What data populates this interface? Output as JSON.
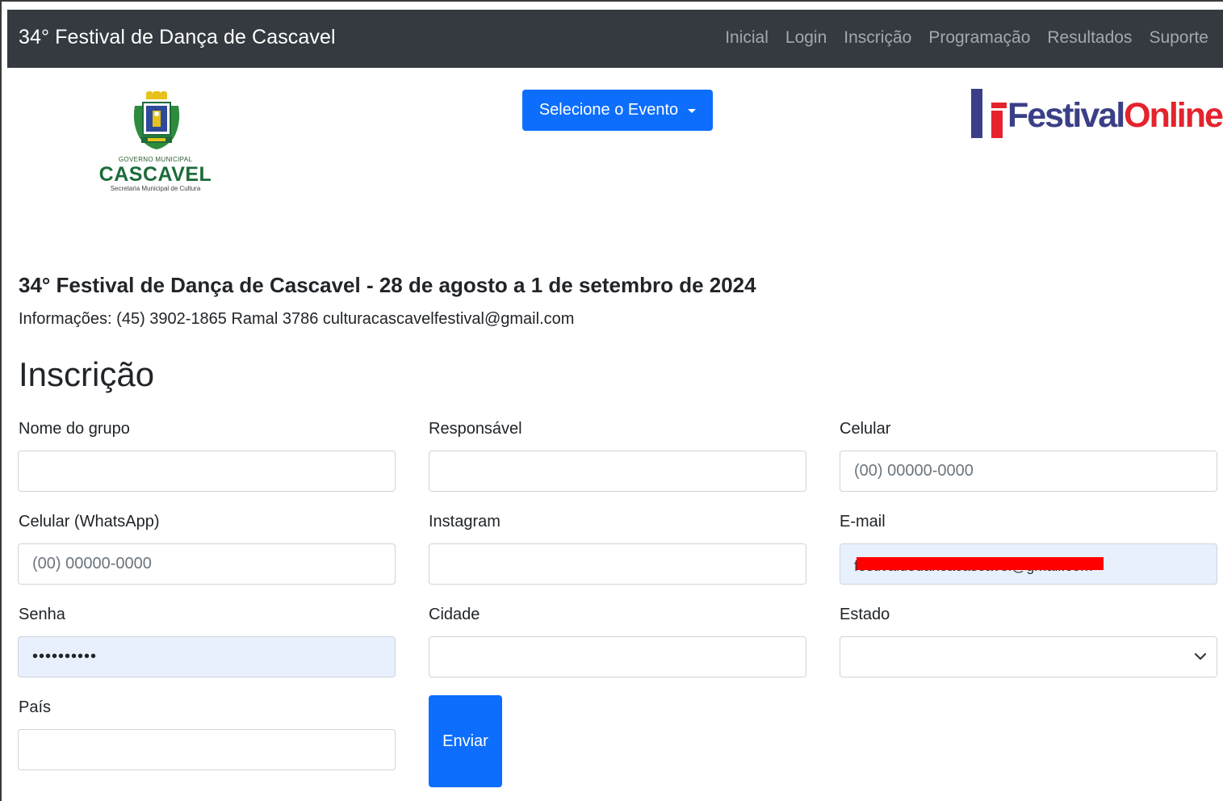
{
  "navbar": {
    "brand": "34° Festival de Dança de Cascavel",
    "links": [
      "Inicial",
      "Login",
      "Inscrição",
      "Programação",
      "Resultados",
      "Suporte"
    ]
  },
  "logos": {
    "left": {
      "line1": "GOVERNO MUNICIPAL",
      "line2": "CASCAVEL",
      "line3": "Secretaria Municipal de Cultura"
    },
    "right": {
      "part1": "Festival",
      "part2": "Online"
    }
  },
  "event_dropdown": {
    "label": "Selecione o Evento"
  },
  "event": {
    "title": "34° Festival de Dança de Cascavel - 28 de agosto a 1 de setembro de 2024",
    "info": "Informações: (45) 3902-1865 Ramal 3786 culturacascavelfestival@gmail.com"
  },
  "form": {
    "title": "Inscrição",
    "fields": {
      "nome_grupo": {
        "label": "Nome do grupo",
        "value": "",
        "placeholder": ""
      },
      "responsavel": {
        "label": "Responsável",
        "value": "",
        "placeholder": ""
      },
      "celular": {
        "label": "Celular",
        "value": "",
        "placeholder": "(00) 00000-0000"
      },
      "whatsapp": {
        "label": "Celular (WhatsApp)",
        "value": "",
        "placeholder": "(00) 00000-0000"
      },
      "instagram": {
        "label": "Instagram",
        "value": "",
        "placeholder": ""
      },
      "email": {
        "label": "E-mail",
        "value": "festivaldedancacascavel@gmail.com",
        "redacted": true
      },
      "senha": {
        "label": "Senha",
        "value": "••••••••••"
      },
      "cidade": {
        "label": "Cidade",
        "value": ""
      },
      "estado": {
        "label": "Estado",
        "value": ""
      },
      "pais": {
        "label": "País",
        "value": ""
      }
    },
    "submit_label": "Enviar"
  },
  "colors": {
    "navbar_bg": "#343a40",
    "primary": "#0d6efd",
    "autofill_bg": "#e8f0fe",
    "redaction": "#ff0000"
  }
}
